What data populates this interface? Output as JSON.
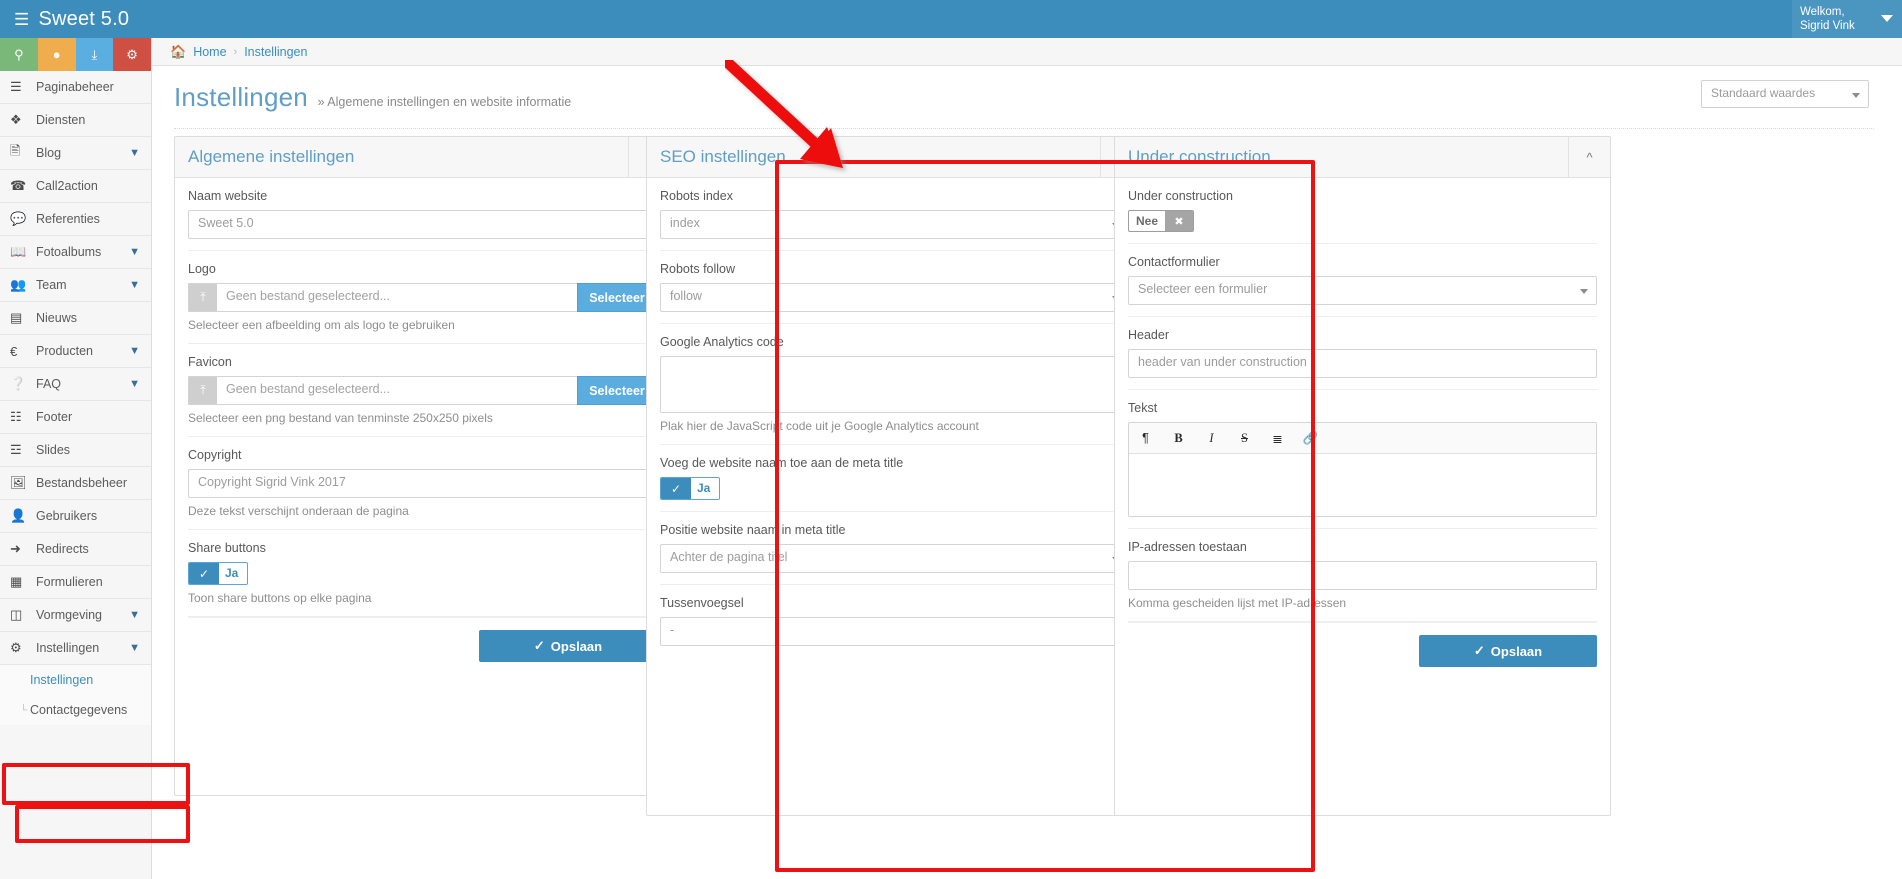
{
  "app": {
    "brand": "Sweet 5.0",
    "brand_icon": "server-icon",
    "user_greeting": "Welkom,",
    "user_name": "Sigrid Vink"
  },
  "quickbar": [
    {
      "name": "map-marker-icon",
      "glyph": "⚉",
      "color": "#7ab87a"
    },
    {
      "name": "user-icon",
      "glyph": "●",
      "color": "#f0ad4e"
    },
    {
      "name": "download-icon",
      "glyph": "⤓",
      "color": "#5bafe0"
    },
    {
      "name": "gears-icon",
      "glyph": "⚙",
      "color": "#cf4f42"
    }
  ],
  "sidebar": {
    "items": [
      {
        "label": "Paginabeheer",
        "icon": "bars-icon",
        "glyph": "☰",
        "chevron": false
      },
      {
        "label": "Diensten",
        "icon": "cubes-icon",
        "glyph": "❖",
        "chevron": false
      },
      {
        "label": "Blog",
        "icon": "file-text-icon",
        "glyph": "☰",
        "chevron": true
      },
      {
        "label": "Call2action",
        "icon": "bullhorn-icon",
        "glyph": "☎",
        "chevron": false
      },
      {
        "label": "Referenties",
        "icon": "comment-icon",
        "glyph": "◯",
        "chevron": false
      },
      {
        "label": "Fotoalbums",
        "icon": "book-icon",
        "glyph": "❐",
        "chevron": true
      },
      {
        "label": "Team",
        "icon": "users-icon",
        "glyph": "♟",
        "chevron": true
      },
      {
        "label": "Nieuws",
        "icon": "newspaper-icon",
        "glyph": "▤",
        "chevron": false
      },
      {
        "label": "Producten",
        "icon": "euro-icon",
        "glyph": "€",
        "chevron": true
      },
      {
        "label": "FAQ",
        "icon": "question-circle-icon",
        "glyph": "?",
        "chevron": true
      },
      {
        "label": "Footer",
        "icon": "list-alt-icon",
        "glyph": "≡",
        "chevron": false
      },
      {
        "label": "Slides",
        "icon": "sliders-icon",
        "glyph": "☲",
        "chevron": false
      },
      {
        "label": "Bestandsbeheer",
        "icon": "image-icon",
        "glyph": "⛰",
        "chevron": false
      },
      {
        "label": "Gebruikers",
        "icon": "user-icon",
        "glyph": "●",
        "chevron": false
      },
      {
        "label": "Redirects",
        "icon": "arrow-circle-right-icon",
        "glyph": "→",
        "chevron": false
      },
      {
        "label": "Formulieren",
        "icon": "wpforms-icon",
        "glyph": "▦",
        "chevron": false
      },
      {
        "label": "Vormgeving",
        "icon": "columns-icon",
        "glyph": "◫",
        "chevron": true
      },
      {
        "label": "Instellingen",
        "icon": "cog-icon",
        "glyph": "⚙",
        "chevron": true
      }
    ],
    "submenu": [
      {
        "label": "Instellingen",
        "active": true
      },
      {
        "label": "Contactgegevens",
        "active": false
      }
    ]
  },
  "breadcrumb": {
    "home_icon": "home-icon",
    "home": "Home",
    "separator": "›",
    "current": "Instellingen"
  },
  "page": {
    "title": "Instellingen",
    "subtitle": "» Algemene instellingen en website informatie",
    "preset_value": "Standaard waardes"
  },
  "panels": {
    "general": {
      "title": "Algemene instellingen",
      "collapse_icon": "chevron-up-icon",
      "fields": {
        "site_name_label": "Naam website",
        "site_name_value": "Sweet 5.0",
        "logo_label": "Logo",
        "logo_value": "Geen bestand geselecteerd...",
        "logo_button": "Selecteer",
        "logo_help": "Selecteer een afbeelding om als logo te gebruiken",
        "favicon_label": "Favicon",
        "favicon_value": "Geen bestand geselecteerd...",
        "favicon_button": "Selecteer",
        "favicon_help": "Selecteer een png bestand van tenminste 250x250 pixels",
        "copyright_label": "Copyright",
        "copyright_value": "Copyright Sigrid Vink 2017",
        "copyright_help": "Deze tekst verschijnt onderaan de pagina",
        "share_label": "Share buttons",
        "share_toggle": "Ja",
        "share_help": "Toon share buttons op elke pagina"
      },
      "save_label": "Opslaan"
    },
    "seo": {
      "title": "SEO instellingen",
      "collapse_icon": "chevron-up-icon",
      "fields": {
        "robots_index_label": "Robots index",
        "robots_index_value": "index",
        "robots_follow_label": "Robots follow",
        "robots_follow_value": "follow",
        "ga_label": "Google Analytics code",
        "ga_value": "",
        "ga_help": "Plak hier de JavaScript code uit je Google Analytics account",
        "meta_title_label": "Voeg de website naam toe aan de meta title",
        "meta_title_toggle": "Ja",
        "position_label": "Positie website naam in meta title",
        "position_value": "Achter de pagina titel",
        "separator_label": "Tussenvoegsel",
        "separator_value": "-"
      }
    },
    "under_construction": {
      "title": "Under construction",
      "collapse_icon": "chevron-up-icon",
      "fields": {
        "uc_label": "Under construction",
        "uc_chip_label": "Nee",
        "uc_chip_icon": "times-icon",
        "contactform_label": "Contactformulier",
        "contactform_value": "Selecteer een formulier",
        "header_label": "Header",
        "header_value": "header van under construction",
        "text_label": "Tekst",
        "editor_buttons": [
          {
            "name": "paragraph-icon",
            "glyph": "¶"
          },
          {
            "name": "bold-icon",
            "glyph": "B"
          },
          {
            "name": "italic-icon",
            "glyph": "I"
          },
          {
            "name": "strikethrough-icon",
            "glyph": "S"
          },
          {
            "name": "list-icon",
            "glyph": "☰"
          },
          {
            "name": "link-icon",
            "glyph": "🔗"
          }
        ],
        "ip_label": "IP-adressen toestaan",
        "ip_value": "",
        "ip_help": "Komma gescheiden lijst met IP-adressen"
      },
      "save_label": "Opslaan"
    }
  },
  "annotations": {
    "accent_color": "#ee1111"
  }
}
